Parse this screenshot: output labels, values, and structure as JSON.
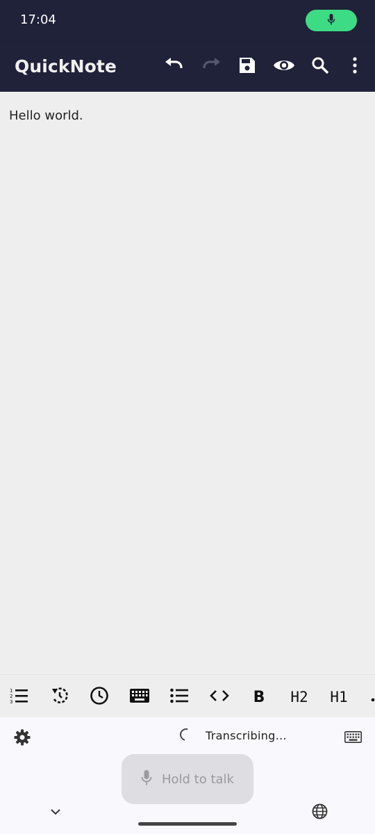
{
  "status_bar": {
    "time": "17:04",
    "indicator_icon": "mic-icon",
    "indicator_color": "#3ddc84"
  },
  "app_bar": {
    "title": "QuickNote",
    "background": "#1f2239",
    "actions": [
      "undo-icon",
      "redo-icon",
      "save-icon",
      "eye-icon",
      "search-icon",
      "more-vert-icon"
    ]
  },
  "editor": {
    "content": "Hello world."
  },
  "markdown_toolbar": {
    "items": [
      {
        "name": "numbered-list-icon"
      },
      {
        "name": "restore-icon"
      },
      {
        "name": "clock-icon"
      },
      {
        "name": "keyboard-icon"
      },
      {
        "name": "bullet-list-icon"
      },
      {
        "name": "code-icon",
        "label": "<>"
      },
      {
        "name": "bold",
        "label": "B"
      },
      {
        "name": "heading-2",
        "label": "H2"
      },
      {
        "name": "heading-1",
        "label": "H1"
      },
      {
        "name": "more-icon"
      }
    ]
  },
  "voice_keyboard": {
    "status_text": "Transcribing…",
    "hold_button_label": "Hold to talk",
    "icons": [
      "gear-icon",
      "keyboard-icon",
      "chevron-down-icon",
      "globe-icon",
      "mic-icon"
    ]
  }
}
